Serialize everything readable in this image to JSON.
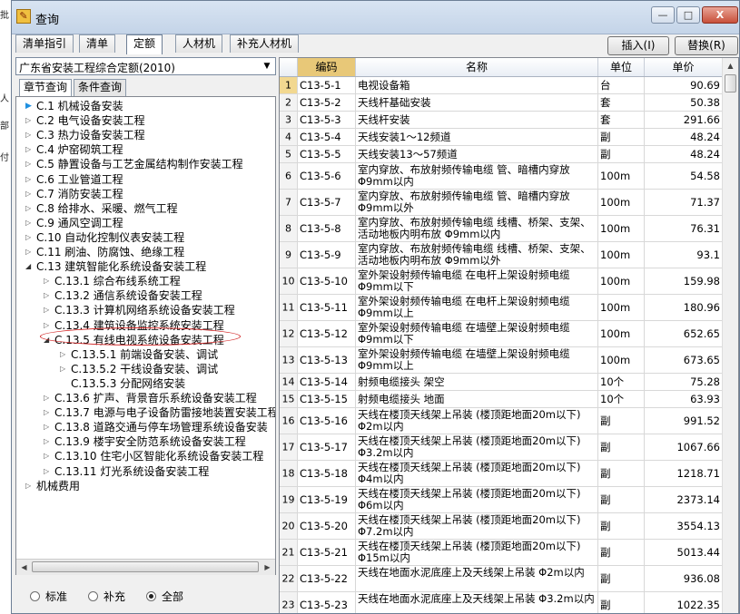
{
  "window": {
    "title": "查询",
    "minimize": "—",
    "maximize": "□",
    "close": "X"
  },
  "tabs": [
    "清单指引",
    "清单",
    "定额",
    "人材机",
    "补充人材机"
  ],
  "buttons": {
    "insert": "插入(I)",
    "replace": "替换(R)"
  },
  "left": {
    "dropdown_value": "广东省安装工程综合定额(2010)",
    "subtabs": [
      "章节查询",
      "条件查询"
    ],
    "tree": [
      {
        "label": "C.1 机械设备安装",
        "state": "leaf"
      },
      {
        "label": "C.2 电气设备安装工程",
        "state": "closed"
      },
      {
        "label": "C.3 热力设备安装工程",
        "state": "closed"
      },
      {
        "label": "C.4 炉窑砌筑工程",
        "state": "closed"
      },
      {
        "label": "C.5 静置设备与工艺金属结构制作安装工程",
        "state": "closed"
      },
      {
        "label": "C.6 工业管道工程",
        "state": "closed"
      },
      {
        "label": "C.7 消防安装工程",
        "state": "closed"
      },
      {
        "label": "C.8 给排水、采暖、燃气工程",
        "state": "closed"
      },
      {
        "label": "C.9 通风空调工程",
        "state": "closed"
      },
      {
        "label": "C.10 自动化控制仪表安装工程",
        "state": "closed"
      },
      {
        "label": "C.11 刷油、防腐蚀、绝缘工程",
        "state": "closed"
      },
      {
        "label": "C.13 建筑智能化系统设备安装工程",
        "state": "open"
      },
      {
        "label": "C.13.1 综合布线系统工程",
        "state": "closed"
      },
      {
        "label": "C.13.2 通信系统设备安装工程",
        "state": "closed"
      },
      {
        "label": "C.13.3 计算机网络系统设备安装工程",
        "state": "closed"
      },
      {
        "label": "C.13.4 建筑设备监控系统安装工程",
        "state": "closed"
      },
      {
        "label": "C.13.5 有线电视系统设备安装工程",
        "state": "open"
      },
      {
        "label": "C.13.5.1 前端设备安装、调试",
        "state": "closed"
      },
      {
        "label": "C.13.5.2 干线设备安装、调试",
        "state": "closed"
      },
      {
        "label": "C.13.5.3 分配网络安装",
        "state": "none"
      },
      {
        "label": "C.13.6 扩声、背景音乐系统设备安装工程",
        "state": "closed"
      },
      {
        "label": "C.13.7 电源与电子设备防雷接地装置安装工程",
        "state": "closed"
      },
      {
        "label": "C.13.8 道路交通与停车场管理系统设备安装",
        "state": "closed"
      },
      {
        "label": "C.13.9 楼宇安全防范系统设备安装工程",
        "state": "closed"
      },
      {
        "label": "C.13.10 住宅小区智能化系统设备安装工程",
        "state": "closed"
      },
      {
        "label": "C.13.11 灯光系统设备安装工程",
        "state": "closed"
      },
      {
        "label": "机械费用",
        "state": "closed"
      }
    ],
    "radios": [
      {
        "label": "标准",
        "checked": false
      },
      {
        "label": "补充",
        "checked": false
      },
      {
        "label": "全部",
        "checked": true
      }
    ]
  },
  "grid": {
    "headers": {
      "code": "编码",
      "name": "名称",
      "unit": "单位",
      "price": "单价"
    },
    "rows": [
      {
        "n": "1",
        "code": "C13-5-1",
        "name": "电视设备箱",
        "unit": "台",
        "price": "90.69"
      },
      {
        "n": "2",
        "code": "C13-5-2",
        "name": "天线杆基础安装",
        "unit": "套",
        "price": "50.38"
      },
      {
        "n": "3",
        "code": "C13-5-3",
        "name": "天线杆安装",
        "unit": "套",
        "price": "291.66"
      },
      {
        "n": "4",
        "code": "C13-5-4",
        "name": "天线安装1～12频道",
        "unit": "副",
        "price": "48.24"
      },
      {
        "n": "5",
        "code": "C13-5-5",
        "name": "天线安装13～57频道",
        "unit": "副",
        "price": "48.24"
      },
      {
        "n": "6",
        "code": "C13-5-6",
        "name": "室内穿放、布放射频传输电缆 管、暗槽内穿放 Φ9mm以内",
        "unit": "100m",
        "price": "54.58"
      },
      {
        "n": "7",
        "code": "C13-5-7",
        "name": "室内穿放、布放射频传输电缆 管、暗槽内穿放 Φ9mm以外",
        "unit": "100m",
        "price": "71.37"
      },
      {
        "n": "8",
        "code": "C13-5-8",
        "name": "室内穿放、布放射频传输电缆 线槽、桥架、支架、活动地板内明布放 Φ9mm以内",
        "unit": "100m",
        "price": "76.31"
      },
      {
        "n": "9",
        "code": "C13-5-9",
        "name": "室内穿放、布放射频传输电缆 线槽、桥架、支架、活动地板内明布放 Φ9mm以外",
        "unit": "100m",
        "price": "93.1"
      },
      {
        "n": "10",
        "code": "C13-5-10",
        "name": "室外架设射频传输电缆 在电杆上架设射频电缆 Φ9mm以下",
        "unit": "100m",
        "price": "159.98"
      },
      {
        "n": "11",
        "code": "C13-5-11",
        "name": "室外架设射频传输电缆 在电杆上架设射频电缆 Φ9mm以上",
        "unit": "100m",
        "price": "180.96"
      },
      {
        "n": "12",
        "code": "C13-5-12",
        "name": "室外架设射频传输电缆 在墙壁上架设射频电缆 Φ9mm以下",
        "unit": "100m",
        "price": "652.65"
      },
      {
        "n": "13",
        "code": "C13-5-13",
        "name": "室外架设射频传输电缆 在墙壁上架设射频电缆 Φ9mm以上",
        "unit": "100m",
        "price": "673.65"
      },
      {
        "n": "14",
        "code": "C13-5-14",
        "name": "射频电缆接头 架空",
        "unit": "10个",
        "price": "75.28"
      },
      {
        "n": "15",
        "code": "C13-5-15",
        "name": "射频电缆接头 地面",
        "unit": "10个",
        "price": "63.93"
      },
      {
        "n": "16",
        "code": "C13-5-16",
        "name": "天线在楼顶天线架上吊装 (楼顶距地面20m以下) Φ2m以内",
        "unit": "副",
        "price": "991.52"
      },
      {
        "n": "17",
        "code": "C13-5-17",
        "name": "天线在楼顶天线架上吊装 (楼顶距地面20m以下) Φ3.2m以内",
        "unit": "副",
        "price": "1067.66"
      },
      {
        "n": "18",
        "code": "C13-5-18",
        "name": "天线在楼顶天线架上吊装 (楼顶距地面20m以下) Φ4m以内",
        "unit": "副",
        "price": "1218.71"
      },
      {
        "n": "19",
        "code": "C13-5-19",
        "name": "天线在楼顶天线架上吊装 (楼顶距地面20m以下) Φ6m以内",
        "unit": "副",
        "price": "2373.14"
      },
      {
        "n": "20",
        "code": "C13-5-20",
        "name": "天线在楼顶天线架上吊装 (楼顶距地面20m以下) Φ7.2m以内",
        "unit": "副",
        "price": "3554.13"
      },
      {
        "n": "21",
        "code": "C13-5-21",
        "name": "天线在楼顶天线架上吊装 (楼顶距地面20m以下) Φ15m以内",
        "unit": "副",
        "price": "5013.44"
      },
      {
        "n": "22",
        "code": "C13-5-22",
        "name": "天线在地面水泥底座上及天线架上吊装 Φ2m以内",
        "unit": "副",
        "price": "936.08"
      },
      {
        "n": "23",
        "code": "C13-5-23",
        "name": "天线在地面水泥底座上及天线架上吊装 Φ3.2m以内",
        "unit": "副",
        "price": "1022.35"
      }
    ]
  }
}
